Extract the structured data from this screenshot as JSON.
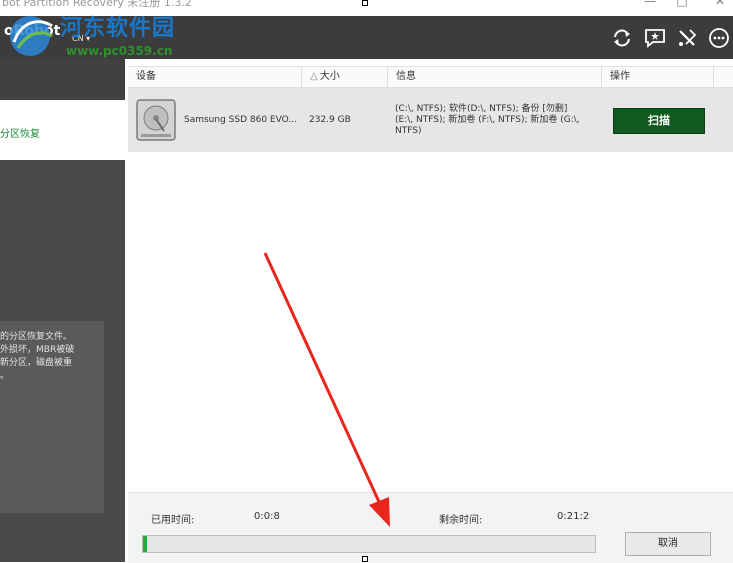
{
  "window": {
    "title": "bot Partition Recovery 未注册 1.3.2",
    "controls": [
      "—",
      "□",
      "✕"
    ]
  },
  "header": {
    "brand": "oRobot",
    "language": "CN ▾",
    "icons": [
      "refresh-icon",
      "feedback-icon",
      "tools-icon",
      "more-icon"
    ]
  },
  "watermark": {
    "line1": "河东软件园",
    "line2": "www.pc0359.cn"
  },
  "sidebar": {
    "active_item": "分区恢复",
    "description": "的分区恢复文件。\n外损坏，MBR被破\n新分区，磁盘被重\n。"
  },
  "table": {
    "columns": [
      "设备",
      "大小",
      "信息",
      "操作"
    ],
    "sort_indicator": "△",
    "rows": [
      {
        "device": "Samsung SSD 860 EVO...",
        "size": "232.9 GB",
        "info_line1": "(C:\\, NTFS); 软件(D:\\, NTFS); 备份 [勿删]",
        "info_line2": "(E:\\, NTFS); 新加卷 (F:\\, NTFS); 新加卷 (G:\\,",
        "info_line3": "NTFS)",
        "action": "扫描"
      }
    ]
  },
  "footer": {
    "elapsed_label": "已用时间:",
    "elapsed_value": "0:0:8",
    "remaining_label": "剩余时间:",
    "remaining_value": "0:21:2",
    "progress_fraction": 0.008,
    "cancel_label": "取消"
  },
  "colors": {
    "header_bg": "#3c3c3c",
    "sidebar_bg": "#4a4a4a",
    "accent_green": "#1b8a3e",
    "scan_button": "#0f5a1f",
    "progress_fill": "#17b33c",
    "annotation_arrow": "#e8261b"
  }
}
